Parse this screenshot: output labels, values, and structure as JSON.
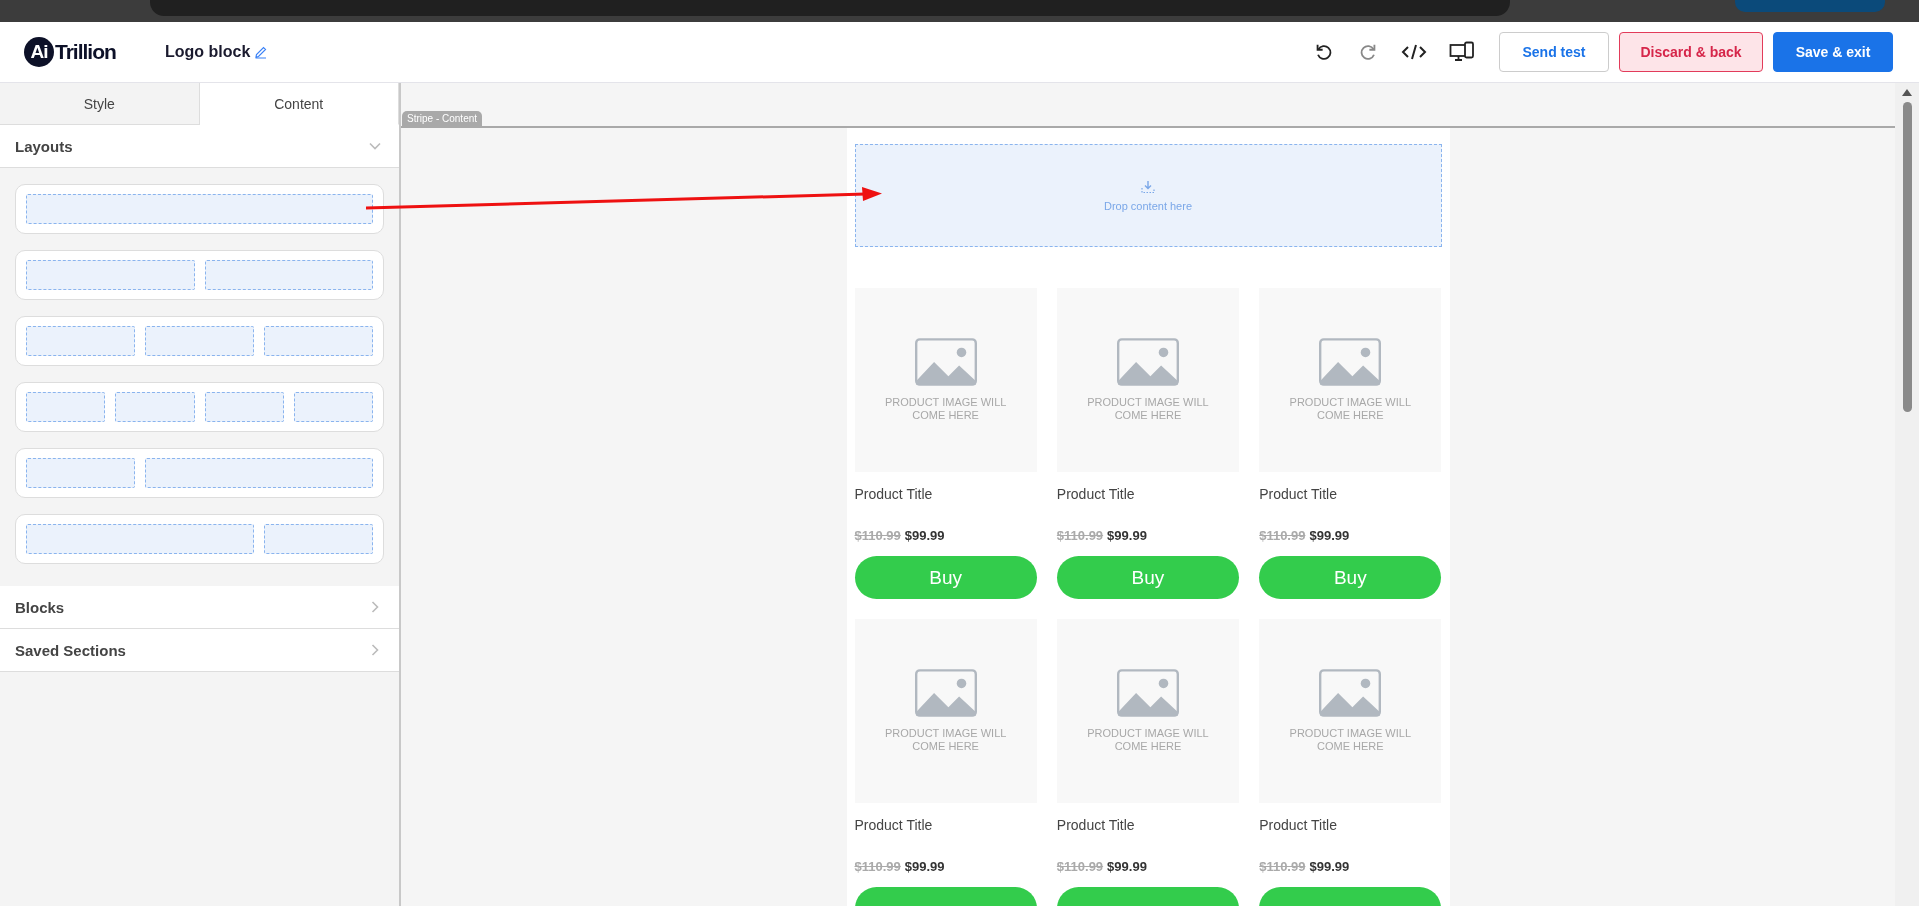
{
  "header": {
    "logo": {
      "mark": "Ai",
      "name": "Trillion"
    },
    "title": "Logo block",
    "actions": [
      {
        "kind": "undo"
      },
      {
        "kind": "redo"
      },
      {
        "kind": "code"
      },
      {
        "kind": "devices"
      }
    ],
    "buttons": [
      {
        "label": "Send test",
        "kind": "outline"
      },
      {
        "label": "Discard & back",
        "kind": "danger"
      },
      {
        "label": "Save & exit",
        "kind": "primary"
      }
    ]
  },
  "sidebar": {
    "tabs": [
      {
        "label": "Style",
        "selected": false
      },
      {
        "label": "Content",
        "selected": true
      }
    ],
    "sections": [
      {
        "label": "Layouts",
        "expanded": true
      },
      {
        "label": "Blocks",
        "expanded": false
      },
      {
        "label": "Saved Sections",
        "expanded": false
      }
    ],
    "layouts": [
      {
        "kind": "one"
      },
      {
        "kind": "two"
      },
      {
        "kind": "three"
      },
      {
        "kind": "four"
      },
      {
        "kind": "narrow-wide"
      },
      {
        "kind": "wide-narrow"
      }
    ]
  },
  "canvas": {
    "stripe_tag": "Stripe - Content",
    "drop_zone": "Drop content here",
    "products": [
      {
        "image_text": "PRODUCT IMAGE WILL COME HERE",
        "title": "Product Title",
        "old_price": "$110.99",
        "price": "$99.99",
        "button": "Buy"
      },
      {
        "image_text": "PRODUCT IMAGE WILL COME HERE",
        "title": "Product Title",
        "old_price": "$110.99",
        "price": "$99.99",
        "button": "Buy"
      },
      {
        "image_text": "PRODUCT IMAGE WILL COME HERE",
        "title": "Product Title",
        "old_price": "$110.99",
        "price": "$99.99",
        "button": "Buy"
      },
      {
        "image_text": "PRODUCT IMAGE WILL COME HERE",
        "title": "Product Title",
        "old_price": "$110.99",
        "price": "$99.99"
      },
      {
        "image_text": "PRODUCT IMAGE WILL COME HERE",
        "title": "Product Title",
        "old_price": "$110.99",
        "price": "$99.99"
      },
      {
        "image_text": "PRODUCT IMAGE WILL COME HERE",
        "title": "Product Title",
        "old_price": "$110.99",
        "price": "$99.99"
      }
    ]
  }
}
